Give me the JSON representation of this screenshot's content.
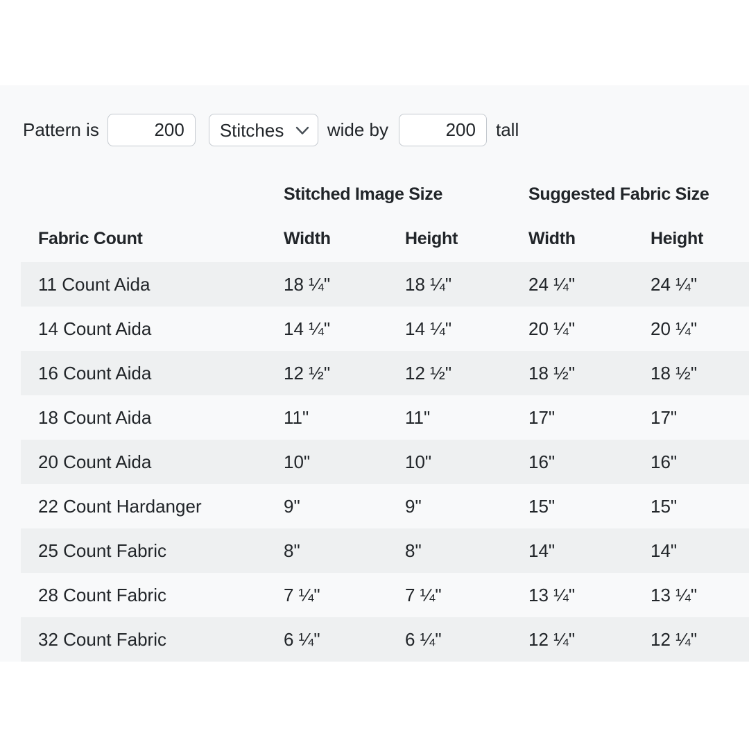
{
  "pattern_form": {
    "label_pattern_is": "Pattern is",
    "width_stitches": "200",
    "units_selected": "Stitches",
    "label_wide_by": "wide by",
    "height_stitches": "200",
    "label_tall": "tall"
  },
  "size_table": {
    "group_header_stitched": "Stitched Image Size",
    "group_header_suggested": "Suggested Fabric Size",
    "col_fabric_count": "Fabric Count",
    "col_stitched_width": "Width",
    "col_stitched_height": "Height",
    "col_fabric_width": "Width",
    "col_fabric_height": "Height",
    "rows": [
      {
        "fabric_count": "11 Count Aida",
        "stitched_width": "18 ¼\"",
        "stitched_height": "18 ¼\"",
        "fabric_width": "24 ¼\"",
        "fabric_height": "24 ¼\""
      },
      {
        "fabric_count": "14 Count Aida",
        "stitched_width": "14 ¼\"",
        "stitched_height": "14 ¼\"",
        "fabric_width": "20 ¼\"",
        "fabric_height": "20 ¼\""
      },
      {
        "fabric_count": "16 Count Aida",
        "stitched_width": "12 ½\"",
        "stitched_height": "12 ½\"",
        "fabric_width": "18 ½\"",
        "fabric_height": "18 ½\""
      },
      {
        "fabric_count": "18 Count Aida",
        "stitched_width": "11\"",
        "stitched_height": "11\"",
        "fabric_width": "17\"",
        "fabric_height": "17\""
      },
      {
        "fabric_count": "20 Count Aida",
        "stitched_width": "10\"",
        "stitched_height": "10\"",
        "fabric_width": "16\"",
        "fabric_height": "16\""
      },
      {
        "fabric_count": "22 Count Hardanger",
        "stitched_width": "9\"",
        "stitched_height": "9\"",
        "fabric_width": "15\"",
        "fabric_height": "15\""
      },
      {
        "fabric_count": "25 Count Fabric",
        "stitched_width": "8\"",
        "stitched_height": "8\"",
        "fabric_width": "14\"",
        "fabric_height": "14\""
      },
      {
        "fabric_count": "28 Count Fabric",
        "stitched_width": "7 ¼\"",
        "stitched_height": "7 ¼\"",
        "fabric_width": "13 ¼\"",
        "fabric_height": "13 ¼\""
      },
      {
        "fabric_count": "32 Count Fabric",
        "stitched_width": "6 ¼\"",
        "stitched_height": "6 ¼\"",
        "fabric_width": "12 ¼\"",
        "fabric_height": "12 ¼\""
      }
    ]
  },
  "icons": {
    "units_select_chevron": "chevron-down"
  },
  "colors": {
    "page_bg": "#ffffff",
    "panel_bg": "#f8f9fa",
    "row_stripe": "#eef0f1",
    "text": "#212529",
    "input_border": "#c4c9cf",
    "chevron": "#495057"
  }
}
